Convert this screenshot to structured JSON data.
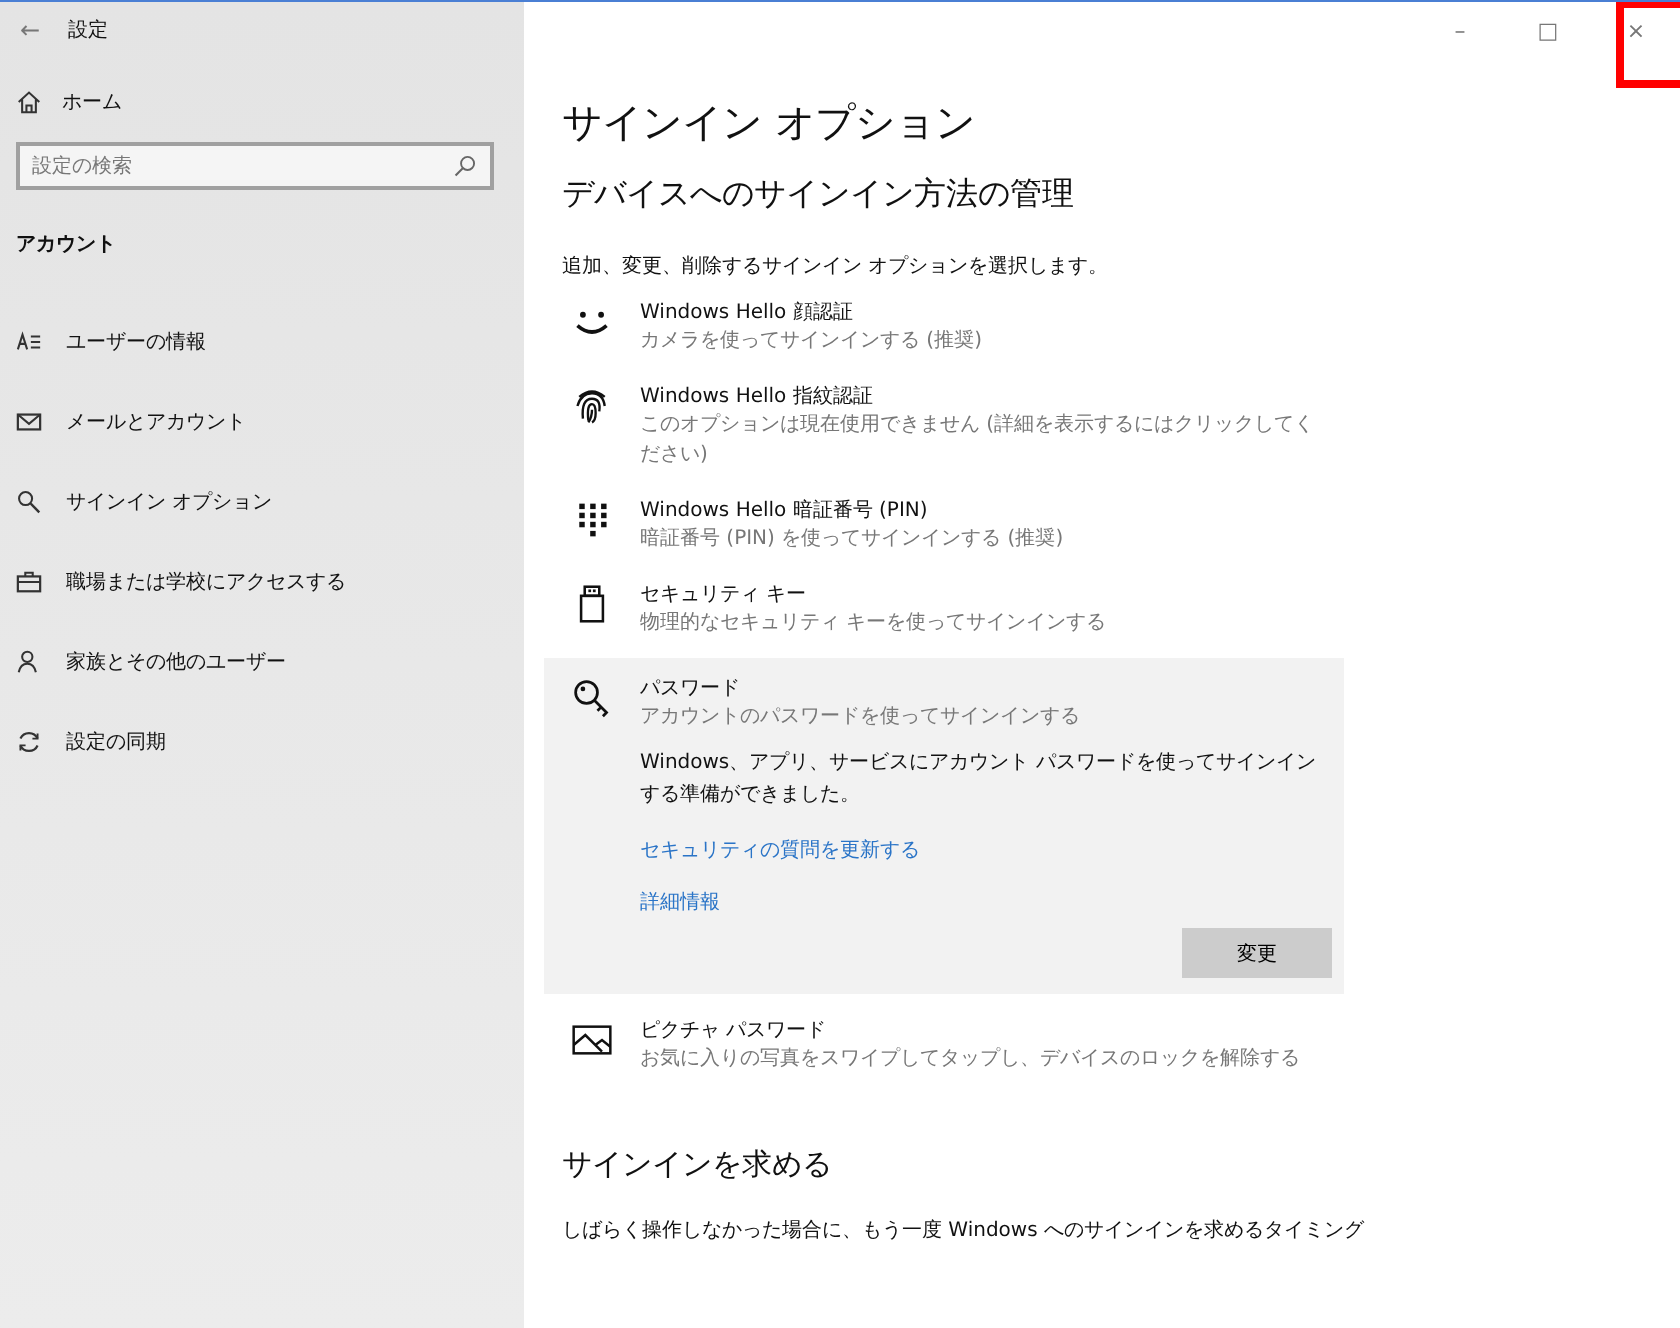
{
  "window": {
    "back": "←",
    "title": "設定",
    "minimize": "–",
    "maximize": "□",
    "close": "×",
    "close_highlighted": true
  },
  "sidebar": {
    "home": "ホーム",
    "search": {
      "placeholder": "設定の検索"
    },
    "section": "アカウント",
    "items": [
      {
        "kind": "user",
        "label": "ユーザーの情報"
      },
      {
        "kind": "mail",
        "label": "メールとアカウント"
      },
      {
        "kind": "key",
        "label": "サインイン オプション"
      },
      {
        "kind": "briefcase",
        "label": "職場または学校にアクセスする"
      },
      {
        "kind": "person",
        "label": "家族とその他のユーザー"
      },
      {
        "kind": "sync",
        "label": "設定の同期"
      }
    ]
  },
  "main": {
    "title": "サインイン オプション",
    "subtitle": "デバイスへのサインイン方法の管理",
    "description": "追加、変更、削除するサインイン オプションを選択します。",
    "options": [
      {
        "kind": "face",
        "name": "Windows Hello 顔認証",
        "detail": "カメラを使ってサインインする (推奨)",
        "expanded": false
      },
      {
        "kind": "fingerprint",
        "name": "Windows Hello 指紋認証",
        "detail": "このオプションは現在使用できません (詳細を表示するにはクリックしてください)",
        "expanded": false
      },
      {
        "kind": "pin",
        "name": "Windows Hello 暗証番号 (PIN)",
        "detail": "暗証番号 (PIN) を使ってサインインする (推奨)",
        "expanded": false
      },
      {
        "kind": "usb",
        "name": "セキュリティ キー",
        "detail": "物理的なセキュリティ キーを使ってサインインする",
        "expanded": false
      },
      {
        "kind": "key",
        "name": "パスワード",
        "detail": "アカウントのパスワードを使ってサインインする",
        "expanded": true,
        "message": "Windows、アプリ、サービスにアカウント パスワードを使ってサインインする準備ができました。",
        "links": [
          "セキュリティの質問を更新する",
          "詳細情報"
        ],
        "button": "変更"
      },
      {
        "kind": "picture",
        "name": "ピクチャ パスワード",
        "detail": "お気に入りの写真をスワイプしてタップし、デバイスのロックを解除する",
        "expanded": false
      }
    ],
    "section_title": "サインインを求める",
    "section_text": "しばらく操作しなかった場合に、もう一度 Windows へのサインインを求めるタイミング"
  }
}
